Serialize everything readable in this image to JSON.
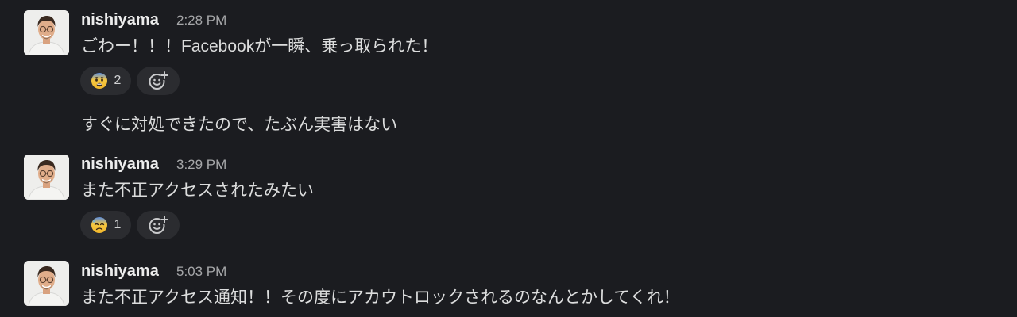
{
  "messages": [
    {
      "author": "nishiyama",
      "time": "2:28 PM",
      "text": "ごわー！！！Facebookが一瞬、乗っ取られた！",
      "reaction": {
        "emoji_name": "fearful-face",
        "count": "2"
      }
    },
    {
      "text": "すぐに対処できたので、たぶん実害はない"
    },
    {
      "author": "nishiyama",
      "time": "3:29 PM",
      "text": "また不正アクセスされたみたい",
      "reaction": {
        "emoji_name": "anxious-face-with-sweat",
        "count": "1"
      }
    },
    {
      "author": "nishiyama",
      "time": "5:03 PM",
      "text": "また不正アクセス通知！！その度にアカウトロックされるのなんとかしてくれ！"
    }
  ],
  "colors": {
    "background": "#1b1c20",
    "reaction_pill": "#2b2c30",
    "author": "#ececec",
    "timestamp": "#a6a7a9",
    "text": "#dcdddd"
  }
}
